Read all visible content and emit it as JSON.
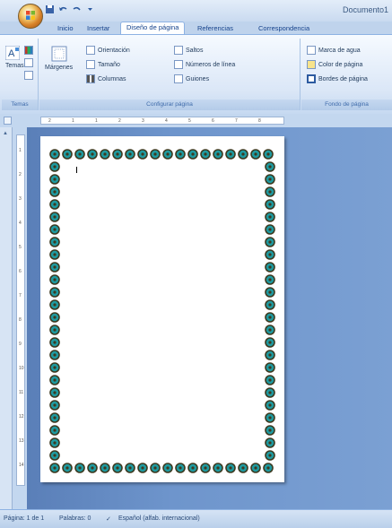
{
  "app": {
    "doc_title": "Documento1"
  },
  "colors": {
    "accent": "#15428b",
    "workspace": "#6e95cc",
    "border_teal": "#1e9aa0",
    "border_dark": "#3d3a20"
  },
  "tabs": [
    "Inicio",
    "Insertar",
    "Diseño de página",
    "Referencias",
    "Correspondencia"
  ],
  "active_tab": "Diseño de página",
  "ribbon": {
    "temas": {
      "label": "Temas",
      "group": "Temas"
    },
    "configurar": {
      "group": "Configurar página",
      "margenes": "Márgenes",
      "orientacion": "Orientación",
      "tamano": "Tamaño",
      "columnas": "Columnas",
      "saltos": "Saltos",
      "numeros_linea": "Números de línea",
      "guiones": "Guiones"
    },
    "fondo": {
      "group": "Fondo de página",
      "marca_agua": "Marca de agua",
      "color_pagina": "Color de página",
      "bordes": "Bordes de página"
    }
  },
  "ruler": {
    "ticks": [
      "2",
      "1",
      "1",
      "2",
      "3",
      "4",
      "5",
      "6",
      "7",
      "8"
    ]
  },
  "vruler": {
    "ticks": [
      "1",
      "2",
      "3",
      "4",
      "5",
      "6",
      "7",
      "8",
      "9",
      "10",
      "11",
      "12",
      "13",
      "14"
    ]
  },
  "status": {
    "page": "Página: 1 de 1",
    "words": "Palabras: 0",
    "language": "Español (alfab. internacional)"
  }
}
